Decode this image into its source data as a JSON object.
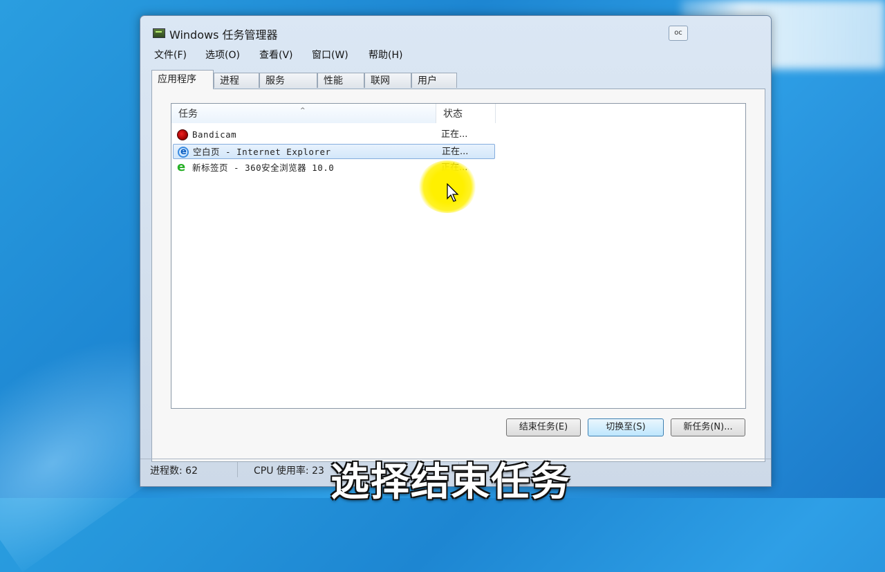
{
  "window": {
    "title": "Windows 任务管理器",
    "control_label": "oc"
  },
  "menu": [
    {
      "label": "文件(F)"
    },
    {
      "label": "选项(O)"
    },
    {
      "label": "查看(V)"
    },
    {
      "label": "窗口(W)"
    },
    {
      "label": "帮助(H)"
    }
  ],
  "tabs": [
    {
      "label": "应用程序",
      "active": true
    },
    {
      "label": "进程"
    },
    {
      "label": "服务"
    },
    {
      "label": "性能"
    },
    {
      "label": "联网"
    },
    {
      "label": "用户"
    }
  ],
  "list": {
    "columns": {
      "task": "任务",
      "status": "状态"
    },
    "sort_indicator": "^",
    "rows": [
      {
        "name": "Bandicam",
        "status": "正在...",
        "icon": "record-icon"
      },
      {
        "name": "空白页 - Internet Explorer",
        "status": "正在...",
        "icon": "ie-icon",
        "selected": true
      },
      {
        "name": "新标签页 - 360安全浏览器 10.0",
        "status": "正在...",
        "icon": "browser-360-icon"
      }
    ]
  },
  "buttons": {
    "end_task": "结束任务(E)",
    "switch_to": "切换至(S)",
    "new_task": "新任务(N)..."
  },
  "statusbar": {
    "process_count": "进程数: 62",
    "cpu_usage": "CPU 使用率: 23"
  },
  "caption": "选择结束任务",
  "colors": {
    "desktop": "#1d86d2",
    "selection": "#d3e7fa",
    "highlight_halo": "#fff000"
  }
}
